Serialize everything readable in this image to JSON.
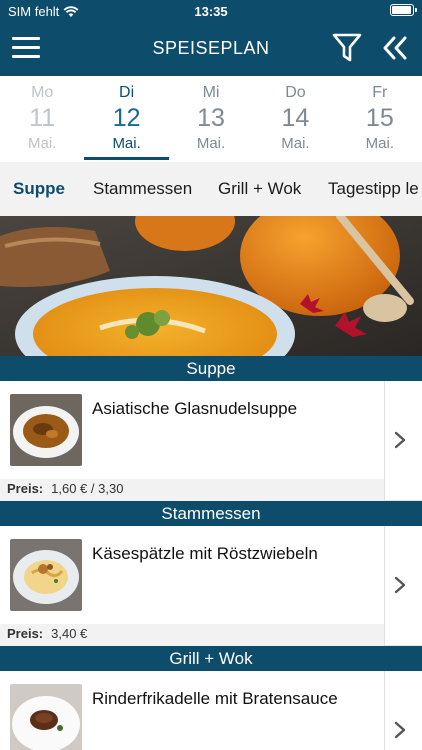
{
  "status": {
    "carrier": "SIM fehlt",
    "time": "13:35"
  },
  "header": {
    "title": "SPEISEPLAN"
  },
  "days": [
    {
      "name": "Mo",
      "num": "11",
      "month": "Mai."
    },
    {
      "name": "Di",
      "num": "12",
      "month": "Mai."
    },
    {
      "name": "Mi",
      "num": "13",
      "month": "Mai."
    },
    {
      "name": "Do",
      "num": "14",
      "month": "Mai."
    },
    {
      "name": "Fr",
      "num": "15",
      "month": "Mai."
    }
  ],
  "categories": [
    "Suppe",
    "Stammessen",
    "Grill + Wok",
    "Tagestipp le"
  ],
  "sections": [
    {
      "title": "Suppe",
      "item": {
        "name": "Asiatische Glasnudelsuppe",
        "price_label": "Preis:",
        "price": "1,60 €  /  3,30"
      }
    },
    {
      "title": "Stammessen",
      "item": {
        "name": "Käsespätzle mit Röstzwiebeln",
        "price_label": "Preis:",
        "price": "3,40 €"
      }
    },
    {
      "title": "Grill + Wok",
      "item": {
        "name": "Rinderfrikadelle mit Bratensauce"
      }
    }
  ],
  "colors": {
    "primary": "#0d4d6b",
    "accent": "#1b6a8f"
  }
}
